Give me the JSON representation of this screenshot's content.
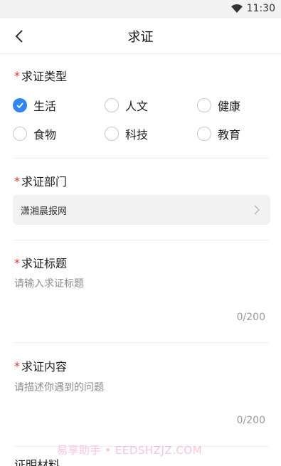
{
  "status_bar": {
    "time": "11:30"
  },
  "nav": {
    "title": "求证"
  },
  "form": {
    "required_mark": "*",
    "category": {
      "label": "求证类型",
      "options": [
        "生活",
        "人文",
        "健康",
        "食物",
        "科技",
        "教育"
      ],
      "selected": "生活"
    },
    "department": {
      "label": "求证部门",
      "value": "潇湘晨报网"
    },
    "title_field": {
      "label": "求证标题",
      "placeholder": "请输入求证标题",
      "counter": "0/200"
    },
    "content_field": {
      "label": "求证内容",
      "placeholder": "请描述你遇到的问题",
      "counter": "0/200"
    },
    "evidence": {
      "label": "证明材料"
    }
  },
  "watermark": "易享助手 • EEDSHZJZ.COM",
  "colors": {
    "accent": "#2f86f6",
    "required": "#e53935"
  },
  "icons": {
    "back": "chevron-left-icon",
    "chevron": "chevron-right-icon",
    "wifi": "wifi-icon",
    "check": "check-icon"
  }
}
